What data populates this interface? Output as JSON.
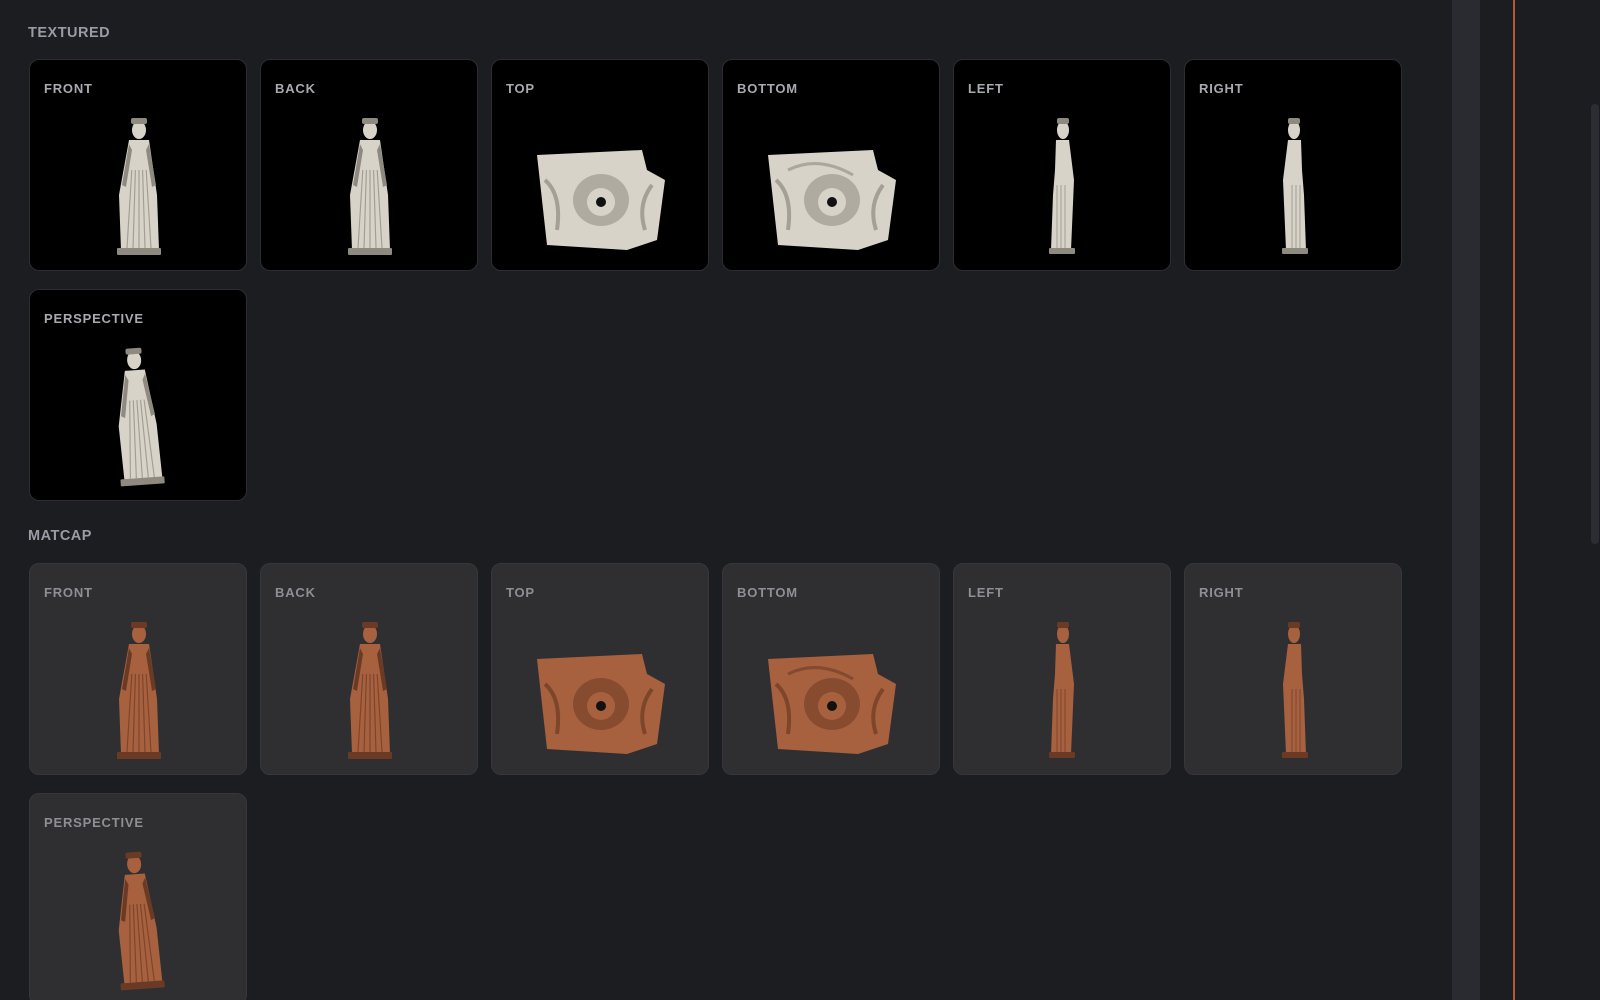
{
  "sections": [
    {
      "title": "TEXTURED",
      "style": "textured",
      "tiles": [
        {
          "label": "FRONT",
          "view": "front"
        },
        {
          "label": "BACK",
          "view": "back"
        },
        {
          "label": "TOP",
          "view": "top"
        },
        {
          "label": "BOTTOM",
          "view": "bottom"
        },
        {
          "label": "LEFT",
          "view": "left"
        },
        {
          "label": "RIGHT",
          "view": "right"
        },
        {
          "label": "PERSPECTIVE",
          "view": "perspective"
        }
      ]
    },
    {
      "title": "MATCAP",
      "style": "matcap",
      "tiles": [
        {
          "label": "FRONT",
          "view": "front"
        },
        {
          "label": "BACK",
          "view": "back"
        },
        {
          "label": "TOP",
          "view": "top"
        },
        {
          "label": "BOTTOM",
          "view": "bottom"
        },
        {
          "label": "LEFT",
          "view": "left"
        },
        {
          "label": "RIGHT",
          "view": "right"
        },
        {
          "label": "PERSPECTIVE",
          "view": "perspective"
        }
      ]
    }
  ],
  "colors": {
    "textured_fill": "#d8d3c8",
    "textured_shade": "#8f8a80",
    "matcap_fill": "#a8613f",
    "matcap_shade": "#6b3a24",
    "accent": "#b25a32"
  }
}
